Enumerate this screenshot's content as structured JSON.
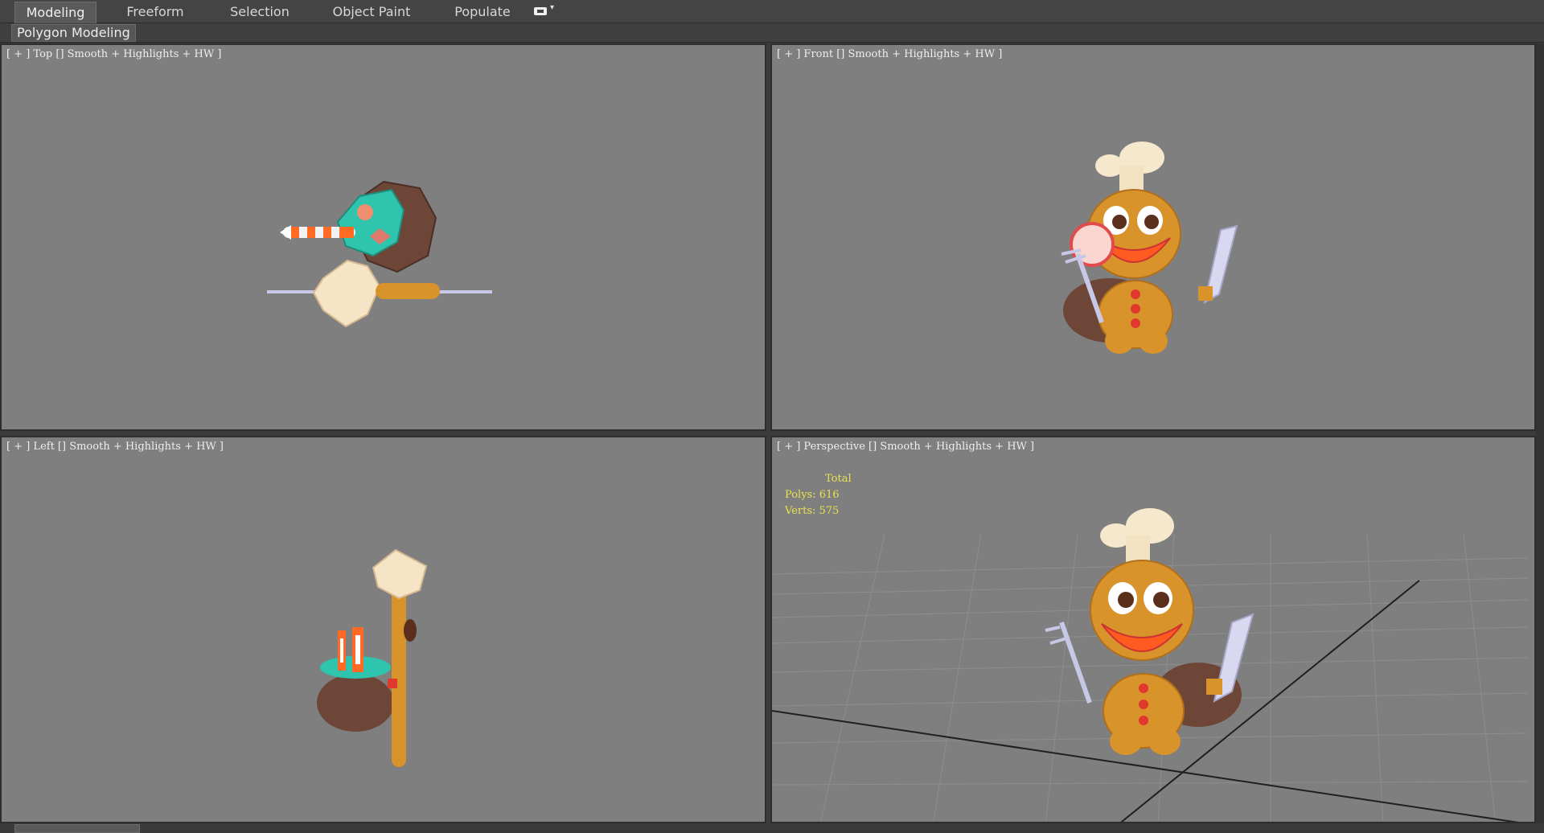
{
  "ribbon": {
    "tabs": [
      {
        "label": "Modeling",
        "active": true
      },
      {
        "label": "Freeform",
        "active": false
      },
      {
        "label": "Selection",
        "active": false
      },
      {
        "label": "Object Paint",
        "active": false
      },
      {
        "label": "Populate",
        "active": false
      }
    ],
    "extra_icon": "ribbon-toggle-icon",
    "panel_label": "Polygon Modeling"
  },
  "viewports": {
    "top": {
      "label": "[ + ] Top [] Smooth + Highlights + HW ]"
    },
    "front": {
      "label": "[ + ] Front [] Smooth + Highlights + HW ]"
    },
    "left": {
      "label": "[ + ] Left [] Smooth + Highlights + HW ]"
    },
    "perspective": {
      "label": "[ + ] Perspective [] Smooth + Highlights + HW ]",
      "stats": {
        "total": "Total",
        "polys": "Polys: 616",
        "verts": "Verts: 575"
      }
    }
  },
  "colors": {
    "viewport_bg": "#7f7f7f",
    "stats_text": "#e9e14f",
    "accent": "#5a5a5a"
  }
}
